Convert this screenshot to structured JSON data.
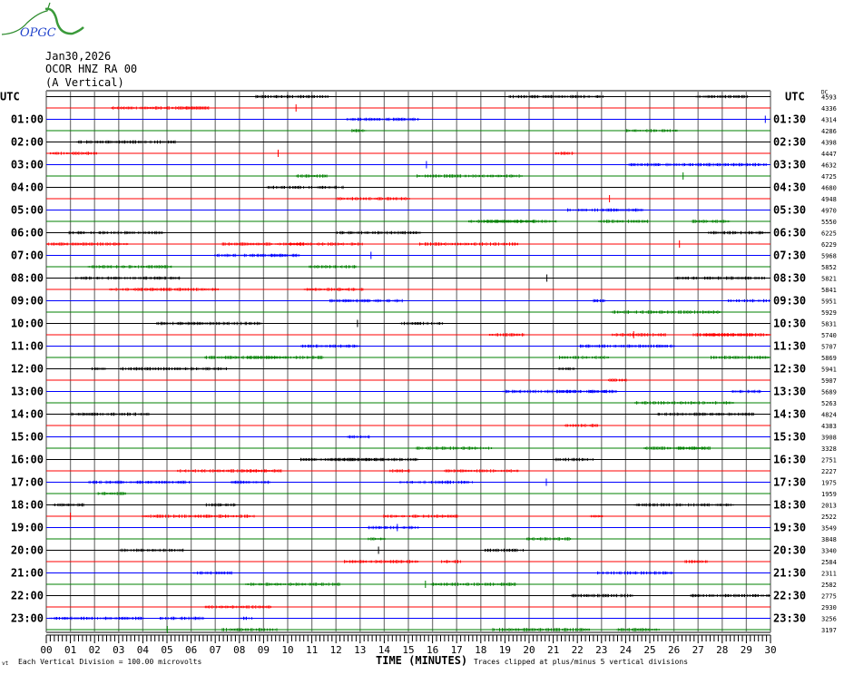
{
  "logo": {
    "text": "OPGC"
  },
  "header": {
    "date": "Jan30,2026",
    "station": "OCOR HNZ RA 00",
    "component": "(A Vertical)"
  },
  "chart_data": {
    "type": "line",
    "title": "Jan30,2026 OCOR HNZ RA 00 (A Vertical)",
    "xlabel": "TIME (MINUTES)",
    "xlim": [
      0,
      30
    ],
    "x_ticks": [
      "00",
      "01",
      "02",
      "03",
      "04",
      "05",
      "06",
      "07",
      "08",
      "09",
      "10",
      "11",
      "12",
      "13",
      "14",
      "15",
      "16",
      "17",
      "18",
      "19",
      "20",
      "21",
      "22",
      "23",
      "24",
      "25",
      "26",
      "27",
      "28",
      "29",
      "30"
    ],
    "left_axis_label": "UTC",
    "right_axis_label": "UTC",
    "left_row_labels": [
      "01:00",
      "02:00",
      "03:00",
      "04:00",
      "05:00",
      "06:00",
      "07:00",
      "08:00",
      "09:00",
      "10:00",
      "11:00",
      "12:00",
      "13:00",
      "14:00",
      "15:00",
      "16:00",
      "17:00",
      "18:00",
      "19:00",
      "20:00",
      "21:00",
      "22:00",
      "23:00"
    ],
    "right_row_labels": [
      "01:30",
      "02:30",
      "03:30",
      "04:30",
      "05:30",
      "06:30",
      "07:30",
      "08:30",
      "09:30",
      "10:30",
      "11:30",
      "12:30",
      "13:30",
      "14:30",
      "15:30",
      "16:30",
      "17:30",
      "18:30",
      "19:30",
      "20:30",
      "21:30",
      "22:30",
      "23:30"
    ],
    "dc_label": "DC",
    "dc_offsets": [
      4593,
      4336,
      4314,
      4286,
      4398,
      4447,
      4632,
      4725,
      4680,
      4948,
      4970,
      5550,
      6225,
      6229,
      5968,
      5852,
      5821,
      5841,
      5951,
      5929,
      5831,
      5740,
      5707,
      5869,
      5941,
      5907,
      5689,
      5263,
      4824,
      4383,
      3908,
      3328,
      2751,
      2227,
      1975,
      1959,
      2013,
      2522,
      3549,
      3848,
      3340,
      2584,
      2311,
      2582,
      2775,
      2930,
      3256,
      3197
    ],
    "trace_colors": [
      "#000000",
      "#ff0000",
      "#0000ff",
      "#008000"
    ],
    "minutes_per_trace": 30,
    "traces_count": 48,
    "scale_note": "Each Vertical Division =  100.00 microvolts",
    "clip_note": "Traces clipped at plus/minus 5 vertical divisions"
  },
  "footer": {
    "corner_mark": "vt"
  }
}
